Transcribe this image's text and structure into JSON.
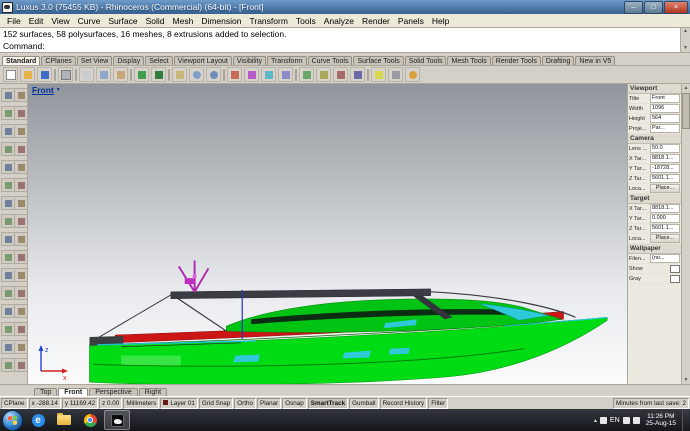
{
  "window": {
    "title": "Luxus 3.0 (75455 KB) - Rhinoceros (Commercial) (64-bit) - [Front]"
  },
  "glyphs": {
    "minimize": "–",
    "maximize": "□",
    "close": "×",
    "caret_down": "▼",
    "scroll_up": "▲",
    "scroll_down": "▼",
    "tray_up": "▴"
  },
  "menu": [
    "File",
    "Edit",
    "View",
    "Curve",
    "Surface",
    "Solid",
    "Mesh",
    "Dimension",
    "Transform",
    "Tools",
    "Analyze",
    "Render",
    "Panels",
    "Help"
  ],
  "command": {
    "history": "152 surfaces, 58 polysurfaces, 16 meshes, 8 extrusions added to selection.",
    "prompt_label": "Command:"
  },
  "toolbar_tabs": [
    {
      "label": "Standard",
      "active": true
    },
    {
      "label": "CPlanes"
    },
    {
      "label": "Set View"
    },
    {
      "label": "Display"
    },
    {
      "label": "Select"
    },
    {
      "label": "Viewport Layout"
    },
    {
      "label": "Visibility"
    },
    {
      "label": "Transform"
    },
    {
      "label": "Curve Tools"
    },
    {
      "label": "Surface Tools"
    },
    {
      "label": "Solid Tools"
    },
    {
      "label": "Mesh Tools"
    },
    {
      "label": "Render Tools"
    },
    {
      "label": "Drafting"
    },
    {
      "label": "New in V5"
    }
  ],
  "toolbar_icons": [
    {
      "name": "new-file"
    },
    {
      "name": "open"
    },
    {
      "name": "save"
    },
    {
      "name": "separator"
    },
    {
      "name": "print"
    },
    {
      "name": "separator"
    },
    {
      "name": "cut"
    },
    {
      "name": "copy"
    },
    {
      "name": "paste"
    },
    {
      "name": "separator"
    },
    {
      "name": "undo"
    },
    {
      "name": "redo"
    },
    {
      "name": "separator"
    },
    {
      "name": "pan"
    },
    {
      "name": "zoom-window"
    },
    {
      "name": "zoom-extents"
    },
    {
      "name": "separator"
    },
    {
      "name": "move"
    },
    {
      "name": "rotate"
    },
    {
      "name": "scale"
    },
    {
      "name": "mirror"
    },
    {
      "name": "separator"
    },
    {
      "name": "join"
    },
    {
      "name": "trim"
    },
    {
      "name": "split"
    },
    {
      "name": "offset"
    },
    {
      "name": "separator"
    },
    {
      "name": "layers"
    },
    {
      "name": "properties"
    },
    {
      "name": "help"
    }
  ],
  "left_toolbar": {
    "count": 32
  },
  "viewport": {
    "label": "Front",
    "axis_x": "x",
    "axis_z": "z"
  },
  "properties_panel": {
    "sections": [
      {
        "title": "Viewport",
        "rows": [
          {
            "label": "Title",
            "value": "Front"
          },
          {
            "label": "Width",
            "value": "1096"
          },
          {
            "label": "Height",
            "value": "564"
          },
          {
            "label": "Proje...",
            "value": "Par..."
          }
        ]
      },
      {
        "title": "Camera",
        "rows": [
          {
            "label": "Lens ...",
            "value": "50.0"
          },
          {
            "label": "X Tar...",
            "value": "8818.1..."
          },
          {
            "label": "Y Tar...",
            "value": "-18728..."
          },
          {
            "label": "Z Tar...",
            "value": "5601.1..."
          },
          {
            "label": "Loca...",
            "value": "Place...",
            "button": true
          }
        ]
      },
      {
        "title": "Target",
        "rows": [
          {
            "label": "X Tar...",
            "value": "8818.1..."
          },
          {
            "label": "Y Tar...",
            "value": "0.000"
          },
          {
            "label": "Z Tar...",
            "value": "5601.1..."
          },
          {
            "label": "Loca...",
            "value": "Place...",
            "button": true
          }
        ]
      },
      {
        "title": "Wallpaper",
        "rows": [
          {
            "label": "Filen...",
            "value": "(no..."
          },
          {
            "label": "Show",
            "checkbox": true
          },
          {
            "label": "Gray",
            "checkbox": true
          }
        ]
      }
    ]
  },
  "viewport_tabs": [
    {
      "label": "Top"
    },
    {
      "label": "Front",
      "active": true
    },
    {
      "label": "Perspective"
    },
    {
      "label": "Right"
    }
  ],
  "status_bar": {
    "cplane": "CPlane",
    "coords": {
      "x": "x -288.14",
      "y": "y 11169.42",
      "z": "z 0.00"
    },
    "units": "Millimeters",
    "layer": {
      "label": "Layer 01",
      "color": "#6b1a1a"
    },
    "toggles": [
      {
        "label": "Grid Snap"
      },
      {
        "label": "Ortho"
      },
      {
        "label": "Planar"
      },
      {
        "label": "Osnap"
      },
      {
        "label": "SmartTrack",
        "active": true
      },
      {
        "label": "Gumball"
      },
      {
        "label": "Record History"
      },
      {
        "label": "Filter"
      }
    ],
    "save_info": "Minutes from last save: 2"
  },
  "taskbar": {
    "apps": [
      {
        "name": "internet-explorer"
      },
      {
        "name": "file-explorer"
      },
      {
        "name": "chrome"
      },
      {
        "name": "rhino",
        "active": true
      }
    ],
    "tray": {
      "lang": "EN",
      "time": "11:26 PM",
      "date": "25-Aug-15"
    }
  },
  "colors": {
    "hull_green": "#00dc14",
    "stripe_red": "#cc1616",
    "detail_cyan": "#2fc9da",
    "antenna_magenta": "#c030c0",
    "hardtop_gray": "#3c3c44",
    "titlebar_blue": "#35608f"
  }
}
